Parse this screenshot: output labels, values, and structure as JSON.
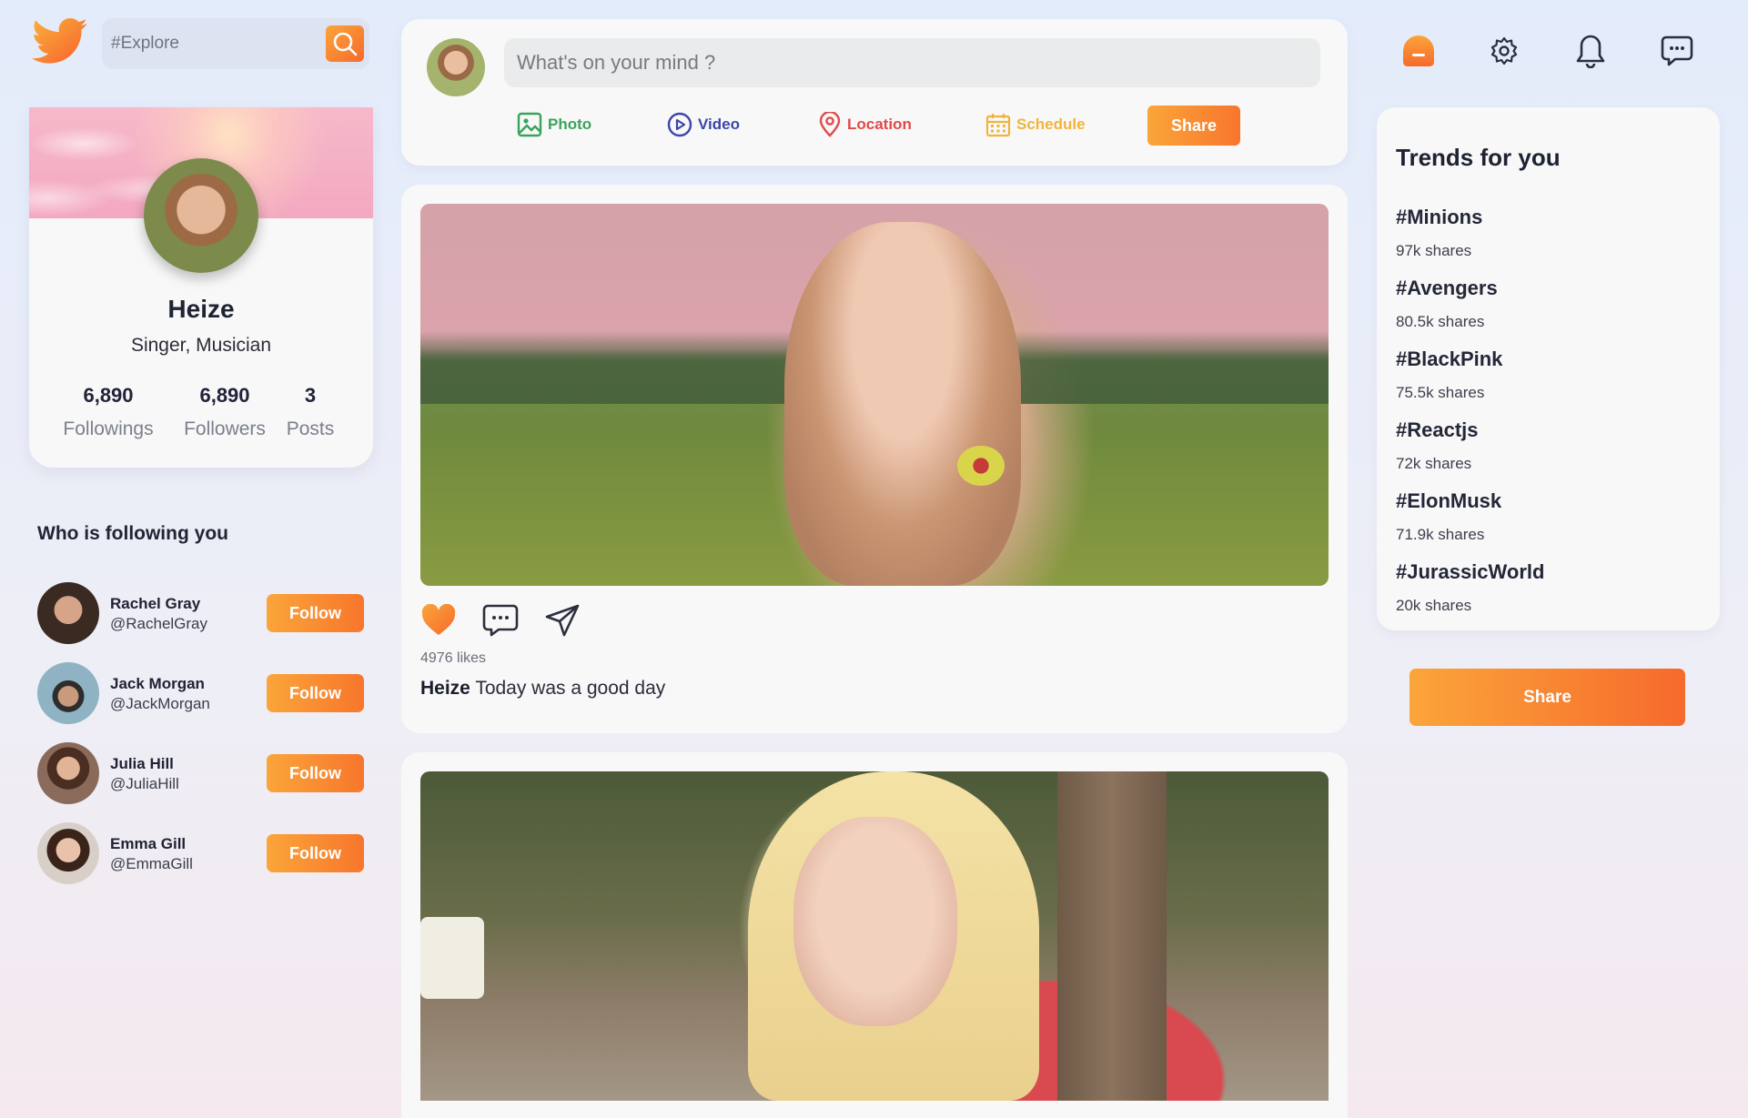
{
  "search": {
    "placeholder": "#Explore"
  },
  "profile": {
    "name": "Heize",
    "bio": "Singer, Musician",
    "stats": [
      {
        "value": "6,890",
        "label": "Followings"
      },
      {
        "value": "6,890",
        "label": "Followers"
      },
      {
        "value": "3",
        "label": "Posts"
      }
    ]
  },
  "followers": {
    "title": "Who is following you",
    "button_label": "Follow",
    "items": [
      {
        "name": "Rachel Gray",
        "handle": "@RachelGray"
      },
      {
        "name": "Jack Morgan",
        "handle": "@JackMorgan"
      },
      {
        "name": "Julia Hill",
        "handle": "@JuliaHill"
      },
      {
        "name": "Emma Gill",
        "handle": "@EmmaGill"
      }
    ]
  },
  "composer": {
    "placeholder": "What's on your mind ?",
    "options": {
      "photo": "Photo",
      "video": "Video",
      "location": "Location",
      "schedule": "Schedule"
    },
    "share_label": "Share"
  },
  "posts": [
    {
      "likes": "4976 likes",
      "author": "Heize",
      "text": " Today was a good day"
    }
  ],
  "trends": {
    "title": "Trends for you",
    "items": [
      {
        "tag": "#Minions",
        "shares": "97k shares"
      },
      {
        "tag": "#Avengers",
        "shares": "80.5k shares"
      },
      {
        "tag": "#BlackPink",
        "shares": "75.5k shares"
      },
      {
        "tag": "#Reactjs",
        "shares": "72k shares"
      },
      {
        "tag": "#ElonMusk",
        "shares": "71.9k shares"
      },
      {
        "tag": "#JurassicWorld",
        "shares": "20k shares"
      }
    ]
  },
  "share_label": "Share",
  "colors": {
    "accent_start": "#fba53a",
    "accent_end": "#f66a2c",
    "photo": "#3aa35a",
    "video": "#3b46a8",
    "location": "#e04a4a",
    "schedule": "#f0b43a"
  },
  "icons": [
    "twitter-bird-icon",
    "search-icon",
    "home-icon",
    "gear-icon",
    "bell-icon",
    "message-icon",
    "heart-icon",
    "comment-icon",
    "send-icon"
  ]
}
